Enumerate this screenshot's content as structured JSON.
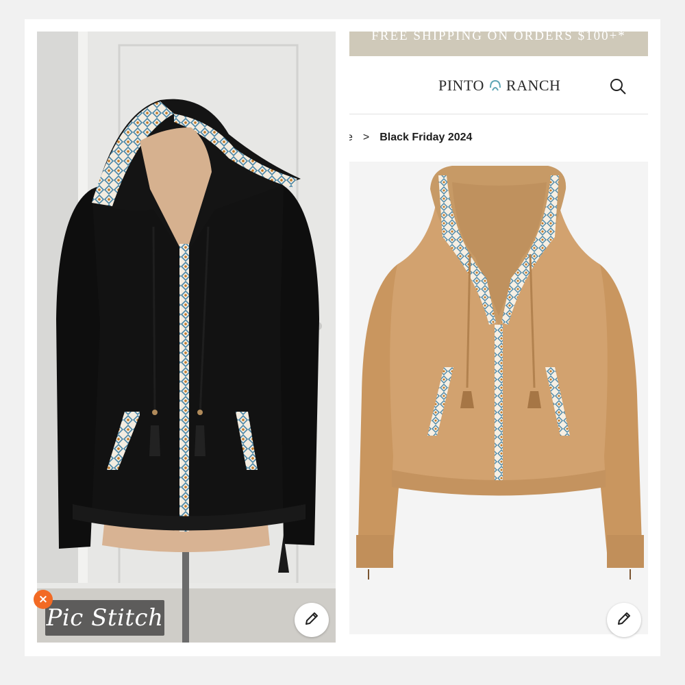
{
  "left_panel": {
    "watermark": "Pic Stitch",
    "close_badge": "×",
    "edit_icon": "pencil-icon"
  },
  "right_panel": {
    "promo_banner": "FREE SHIPPING ON ORDERS $100+*",
    "brand": {
      "name_left": "PINTO",
      "name_right": "RANCH",
      "logo_icon": "horseshoe-logo-icon"
    },
    "search_icon": "search-icon",
    "breadcrumb": {
      "partial": "e",
      "separator": ">",
      "current": "Black Friday 2024"
    },
    "edit_icon": "pencil-icon"
  },
  "colors": {
    "promo_bg": "#cfc9b9",
    "badge": "#f26a24",
    "sweater_black": "#111111",
    "sweater_tan": "#d2a26f"
  }
}
